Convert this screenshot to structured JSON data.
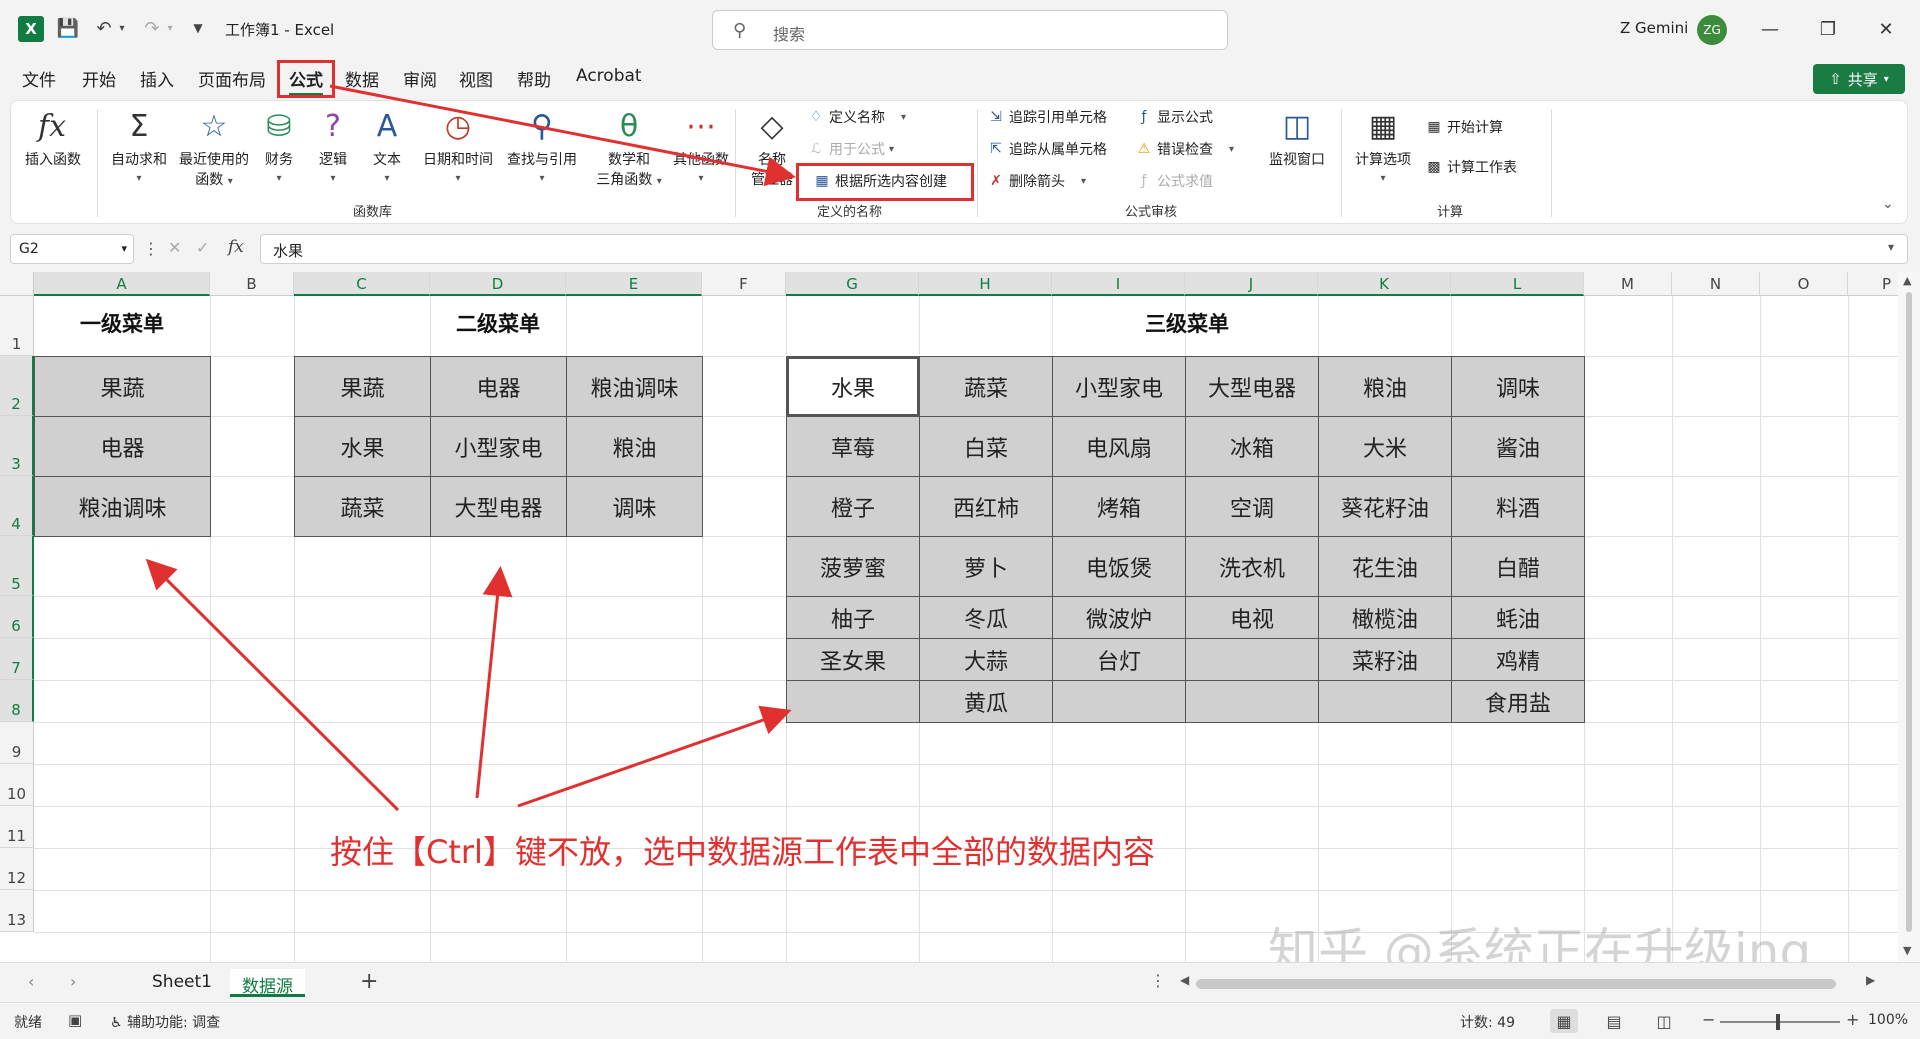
{
  "app": {
    "title": "工作簿1 - Excel",
    "logo": "X",
    "search_placeholder": "搜索",
    "user_name": "Z Gemini",
    "user_initials": "ZG",
    "share_label": "共享"
  },
  "menu_tabs": [
    "文件",
    "开始",
    "插入",
    "页面布局",
    "公式",
    "数据",
    "审阅",
    "视图",
    "帮助",
    "Acrobat"
  ],
  "active_tab": "公式",
  "ribbon": {
    "function_library": {
      "label": "函数库",
      "insert_function": "插入函数",
      "autosum": "自动求和",
      "recent": "最近使用的",
      "recent2": "函数",
      "financial": "财务",
      "logical": "逻辑",
      "text": "文本",
      "datetime": "日期和时间",
      "lookup": "查找与引用",
      "math": "数学和",
      "math2": "三角函数",
      "more": "其他函数"
    },
    "defined_names": {
      "label": "定义的名称",
      "name_manager": "名称",
      "name_manager2": "管理器",
      "define_name": "定义名称",
      "use_in_formula": "用于公式",
      "create_from_selection": "根据所选内容创建"
    },
    "formula_auditing": {
      "label": "公式审核",
      "trace_precedents": "追踪引用单元格",
      "trace_dependents": "追踪从属单元格",
      "remove_arrows": "删除箭头",
      "show_formulas": "显示公式",
      "error_checking": "错误检查",
      "evaluate_formula": "公式求值",
      "watch_window": "监视窗口"
    },
    "calculation": {
      "label": "计算",
      "options": "计算选项",
      "calc_now": "开始计算",
      "calc_sheet": "计算工作表"
    }
  },
  "formula_bar": {
    "name_box": "G2",
    "fx": "fx",
    "value": "水果"
  },
  "columns": [
    "A",
    "B",
    "C",
    "D",
    "E",
    "F",
    "G",
    "H",
    "I",
    "J",
    "K",
    "L",
    "M",
    "N",
    "O",
    "P"
  ],
  "rows": [
    "1",
    "2",
    "3",
    "4",
    "5",
    "6",
    "7",
    "8",
    "9",
    "10",
    "11",
    "12",
    "13"
  ],
  "sheet": {
    "level1_title": "一级菜单",
    "level1": [
      "果蔬",
      "电器",
      "粮油调味"
    ],
    "level2_title": "二级菜单",
    "level2": [
      [
        "果蔬",
        "电器",
        "粮油调味"
      ],
      [
        "水果",
        "小型家电",
        "粮油"
      ],
      [
        "蔬菜",
        "大型电器",
        "调味"
      ]
    ],
    "level3_title": "三级菜单",
    "level3": [
      [
        "水果",
        "蔬菜",
        "小型家电",
        "大型电器",
        "粮油",
        "调味"
      ],
      [
        "草莓",
        "白菜",
        "电风扇",
        "冰箱",
        "大米",
        "酱油"
      ],
      [
        "橙子",
        "西红柿",
        "烤箱",
        "空调",
        "葵花籽油",
        "料酒"
      ],
      [
        "菠萝蜜",
        "萝卜",
        "电饭煲",
        "洗衣机",
        "花生油",
        "白醋"
      ],
      [
        "柚子",
        "冬瓜",
        "微波炉",
        "电视",
        "橄榄油",
        "蚝油"
      ],
      [
        "圣女果",
        "大蒜",
        "台灯",
        "",
        "菜籽油",
        "鸡精"
      ],
      [
        "",
        "黄瓜",
        "",
        "",
        "",
        "食用盐"
      ]
    ]
  },
  "annotation": "按住【Ctrl】键不放，选中数据源工作表中全部的数据内容",
  "watermark": "知乎 @系统正在升级ing",
  "sheet_tabs": [
    "Sheet1",
    "数据源"
  ],
  "active_sheet": "数据源",
  "status": {
    "ready": "就绪",
    "accessibility": "辅助功能: 调查",
    "count": "计数: 49",
    "zoom": "100%"
  },
  "colors": {
    "accent": "#107c41",
    "highlight": "#e0302f",
    "cell_fill": "#d0d0d0"
  }
}
